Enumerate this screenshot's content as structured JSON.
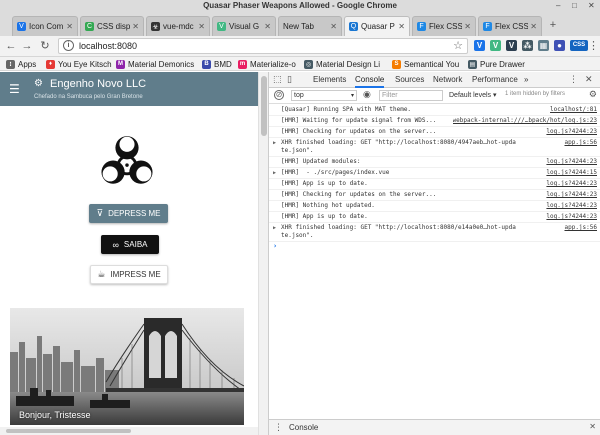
{
  "window": {
    "title": "Quasar Phaser Weapons Allowed - Google Chrome",
    "controls": {
      "minimize": "–",
      "maximize": "□",
      "close": "✕"
    }
  },
  "tabs": [
    {
      "label": "Icon Com",
      "icon": "v-icon",
      "color": "#1a73e8",
      "active": false
    },
    {
      "label": "CSS disp",
      "icon": "css-icon",
      "color": "#33a852",
      "active": false
    },
    {
      "label": "vue-mdc",
      "icon": "biohazard-icon",
      "color": "#333333",
      "active": false
    },
    {
      "label": "Visual G",
      "icon": "vue-icon",
      "color": "#41b883",
      "active": false
    },
    {
      "label": "New Tab",
      "icon": "",
      "color": "#c8c8c8",
      "active": false
    },
    {
      "label": "Quasar P",
      "icon": "quasar-icon",
      "color": "#1976d2",
      "active": true
    },
    {
      "label": "Flex CSS",
      "icon": "flex-icon",
      "color": "#1e88e5",
      "active": false
    },
    {
      "label": "Flex CSS",
      "icon": "flex-icon",
      "color": "#1e88e5",
      "active": false
    }
  ],
  "toolbar": {
    "url": "localhost:8080",
    "info_glyph": "i",
    "extensions": [
      {
        "icon": "v-extension-icon",
        "color": "#1a73e8",
        "glyph": "V"
      },
      {
        "icon": "vue-devtools-icon",
        "color": "#41b883",
        "glyph": "V"
      },
      {
        "icon": "v-dark-icon",
        "color": "#2c3e50",
        "glyph": "V"
      },
      {
        "icon": "grid-icon",
        "color": "#455a64",
        "glyph": "⁂"
      },
      {
        "icon": "puzzle-icon",
        "color": "#607d8b",
        "glyph": "▦"
      },
      {
        "icon": "circle-extension-icon",
        "color": "#3f51b5",
        "glyph": "●"
      },
      {
        "icon": "css-extension-icon",
        "color": "#1565c0",
        "glyph": "CSS"
      }
    ]
  },
  "bookmarks": [
    {
      "label": "Apps",
      "icon": "apps-icon",
      "color": "#666666"
    },
    {
      "label": "You Eye Kitsch",
      "icon": "bookmark-icon",
      "color": "#e53935"
    },
    {
      "label": "Material Demonics",
      "icon": "material-icon",
      "color": "#8e24aa"
    },
    {
      "label": "BMD",
      "icon": "b-icon",
      "color": "#3949ab"
    },
    {
      "label": "Materialize-o",
      "icon": "materialize-icon",
      "color": "#e91e63"
    },
    {
      "label": "Material Design Li",
      "icon": "mdl-icon",
      "color": "#455a64"
    },
    {
      "label": "Semantical You",
      "icon": "semantic-icon",
      "color": "#f57c00"
    },
    {
      "label": "Pure Drawer",
      "icon": "drawer-icon",
      "color": "#455a64"
    }
  ],
  "app": {
    "header": {
      "menu_glyph": "☰",
      "brand": "Engenho Novo LLC",
      "subtitle": "Chefado na Sambuca pelo Gran Bretone",
      "accent": "#607d8b"
    },
    "buttons": {
      "depress": {
        "label": "DEPRESS ME",
        "glyph": "⊽"
      },
      "saiba": {
        "label": "SAIBA",
        "glyph": "∞"
      },
      "impress": {
        "label": "IMPRESS ME",
        "glyph": "☕"
      }
    },
    "card": {
      "caption": "Bonjour, Tristesse"
    }
  },
  "devtools": {
    "tabs": [
      "Elements",
      "Console",
      "Sources",
      "Network",
      "Performance"
    ],
    "active_tab": "Console",
    "more": "»",
    "context": "top",
    "filter_placeholder": "Filter",
    "levels": "Default levels ▾",
    "hidden_info": "1 item hidden by filters",
    "logs": [
      {
        "msg": "[Quasar] Running SPA with MAT theme.",
        "src": "localhost/:81",
        "expand": false
      },
      {
        "msg": "[HMR] Waiting for update signal from WDS...",
        "src": "webpack-internal:///…bpack/hot/log.js:23",
        "expand": false
      },
      {
        "msg": "[HMR] Checking for updates on the server...",
        "src": "log.js?4244:23",
        "expand": false
      },
      {
        "msg": "XHR finished loading: GET \"http://localhost:8080/4947aeb…hot-update.json\".",
        "src": "app.js:56",
        "expand": true
      },
      {
        "msg": "[HMR] Updated modules:",
        "src": "log.js?4244:23",
        "expand": false
      },
      {
        "msg": "[HMR]  - ./src/pages/index.vue",
        "src": "log.js?4244:15",
        "expand": true
      },
      {
        "msg": "[HMR] App is up to date.",
        "src": "log.js?4244:23",
        "expand": false
      },
      {
        "msg": "[HMR] Checking for updates on the server...",
        "src": "log.js?4244:23",
        "expand": false
      },
      {
        "msg": "[HMR] Nothing hot updated.",
        "src": "log.js?4244:23",
        "expand": false
      },
      {
        "msg": "[HMR] App is up to date.",
        "src": "log.js?4244:23",
        "expand": false
      },
      {
        "msg": "XHR finished loading: GET \"http://localhost:8080/e14a0e0…hot-update.json\".",
        "src": "app.js:56",
        "expand": true
      }
    ],
    "drawer_label": "Console"
  }
}
